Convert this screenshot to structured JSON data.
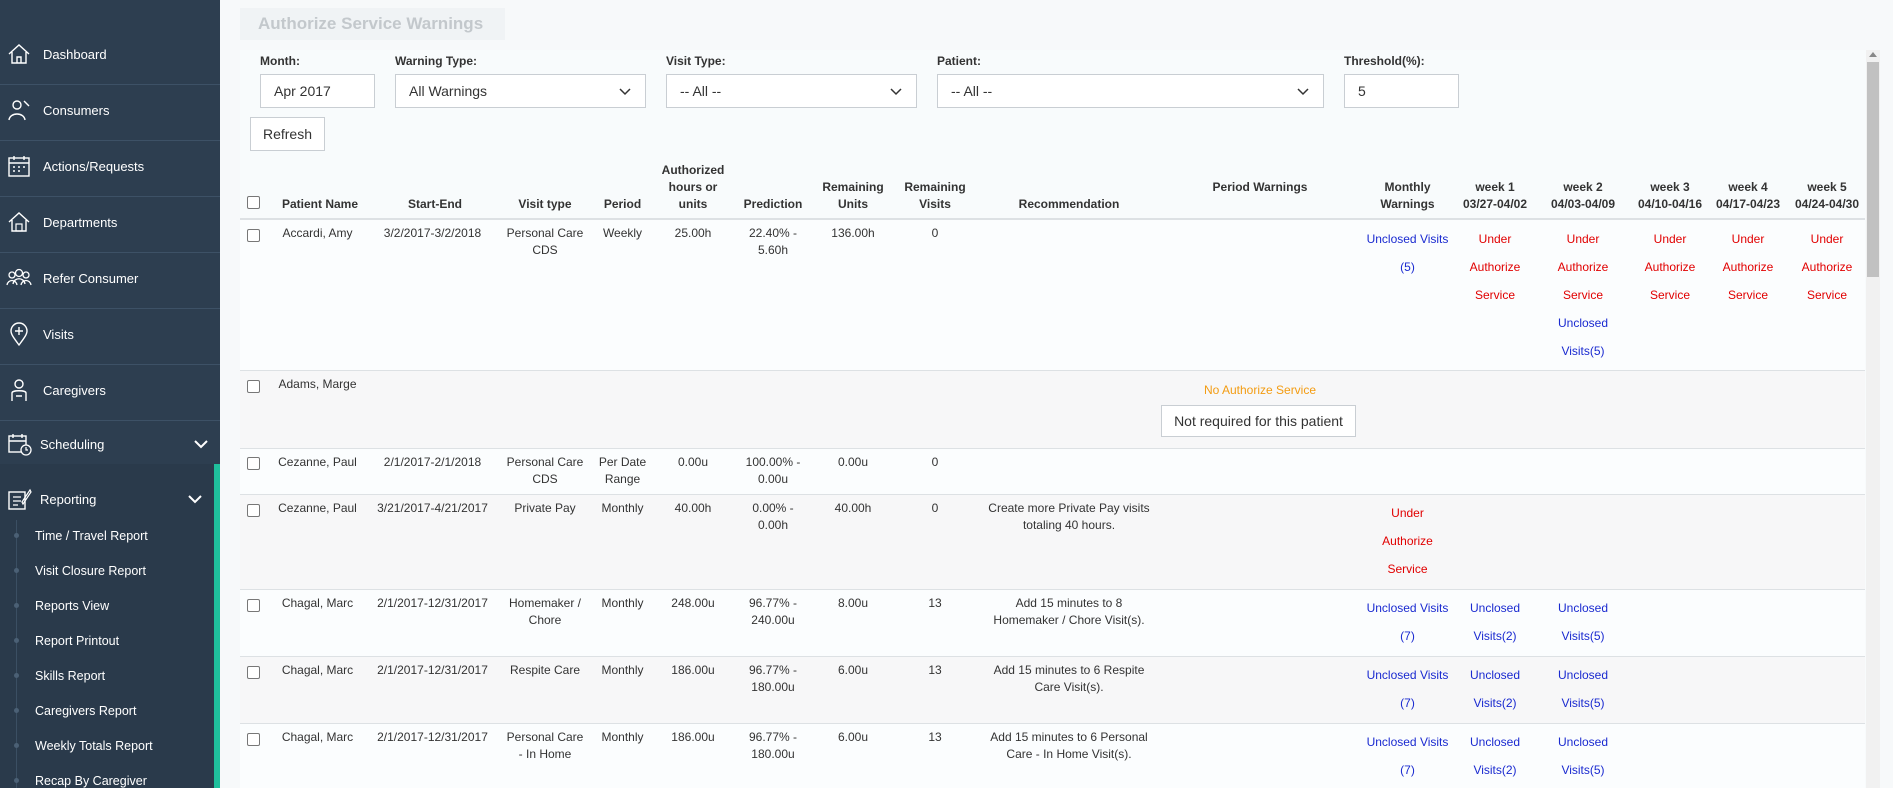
{
  "sidebar": {
    "items": [
      {
        "label": "Dashboard",
        "icon": "home-icon"
      },
      {
        "label": "Consumers",
        "icon": "consumer-icon"
      },
      {
        "label": "Actions/Requests",
        "icon": "calendar-icon"
      },
      {
        "label": "Departments",
        "icon": "building-icon"
      },
      {
        "label": "Refer Consumer",
        "icon": "group-icon"
      },
      {
        "label": "Visits",
        "icon": "location-pin-icon"
      },
      {
        "label": "Caregivers",
        "icon": "caregiver-icon"
      },
      {
        "label": "Scheduling",
        "icon": "schedule-icon"
      },
      {
        "label": "Reporting",
        "icon": "report-icon"
      }
    ],
    "reporting_subitems": [
      "Time / Travel Report",
      "Visit Closure Report",
      "Reports View",
      "Report Printout",
      "Skills Report",
      "Caregivers Report",
      "Weekly Totals Report",
      "Recap By Caregiver"
    ]
  },
  "page": {
    "title": "Authorize Service Warnings"
  },
  "filters": {
    "month_label": "Month:",
    "month_value": "Apr 2017",
    "warning_type_label": "Warning Type:",
    "warning_type_value": "All Warnings",
    "visit_type_label": "Visit Type:",
    "visit_type_value": "-- All --",
    "patient_label": "Patient:",
    "patient_value": "-- All --",
    "threshold_label": "Threshold(%):",
    "threshold_value": "5",
    "refresh_label": "Refresh"
  },
  "table": {
    "headers": {
      "patient_name": "Patient Name",
      "start_end": "Start-End",
      "visit_type": "Visit type",
      "period": "Period",
      "authorized": "Authorized hours or units",
      "prediction": "Prediction",
      "remaining_units": "Remaining Units",
      "remaining_visits": "Remaining Visits",
      "recommendation": "Recommendation",
      "period_warnings": "Period Warnings",
      "monthly_warnings": "Monthly Warnings",
      "week1": "week 1",
      "week1_range": "03/27-04/02",
      "week2": "week 2",
      "week2_range": "04/03-04/09",
      "week3": "week 3",
      "week3_range": "04/10-04/16",
      "week4": "week 4",
      "week4_range": "04/17-04/23",
      "week5": "week 5",
      "week5_range": "04/24-04/30"
    },
    "rows": [
      {
        "name": "Accardi, Amy",
        "start_end": "3/2/2017-3/2/2018",
        "visit_type_1": "Personal Care",
        "visit_type_2": "CDS",
        "period": "Weekly",
        "authorized": "25.00h",
        "prediction_1": "22.40% -",
        "prediction_2": "5.60h",
        "remaining_units": "136.00h",
        "remaining_visits": "0",
        "monthly_1": "Unclosed Visits",
        "monthly_2": "(5)",
        "w_under": "Under",
        "w_authorize": "Authorize",
        "w_service": "Service",
        "w2_unclosed": "Unclosed",
        "w2_visits": "Visits(5)"
      },
      {
        "name": "Adams, Marge",
        "no_auth": "No Authorize Service",
        "not_required": "Not required for this patient"
      },
      {
        "name": "Cezanne, Paul",
        "start_end": "2/1/2017-2/1/2018",
        "visit_type_1": "Personal Care",
        "visit_type_2": "CDS",
        "period_1": "Per Date",
        "period_2": "Range",
        "authorized": "0.00u",
        "prediction_1": "100.00% -",
        "prediction_2": "0.00u",
        "remaining_units": "0.00u",
        "remaining_visits": "0"
      },
      {
        "name": "Cezanne, Paul",
        "start_end": "3/21/2017-4/21/2017",
        "visit_type_1": "Private Pay",
        "period": "Monthly",
        "authorized": "40.00h",
        "prediction_1": "0.00% -",
        "prediction_2": "0.00h",
        "remaining_units": "40.00h",
        "remaining_visits": "0",
        "recommendation_1": "Create more Private Pay visits",
        "recommendation_2": "totaling 40 hours.",
        "monthly_under": "Under",
        "monthly_authorize": "Authorize",
        "monthly_service": "Service"
      },
      {
        "name": "Chagal, Marc",
        "start_end": "2/1/2017-12/31/2017",
        "visit_type_1": "Homemaker /",
        "visit_type_2": "Chore",
        "period": "Monthly",
        "authorized": "248.00u",
        "prediction_1": "96.77% -",
        "prediction_2": "240.00u",
        "remaining_units": "8.00u",
        "remaining_visits": "13",
        "recommendation_1": "Add 15 minutes to 8",
        "recommendation_2": "Homemaker / Chore Visit(s).",
        "monthly_1": "Unclosed Visits",
        "monthly_2": "(7)",
        "w1_1": "Unclosed",
        "w1_2": "Visits(2)",
        "w2_1": "Unclosed",
        "w2_2": "Visits(5)"
      },
      {
        "name": "Chagal, Marc",
        "start_end": "2/1/2017-12/31/2017",
        "visit_type_1": "Respite Care",
        "period": "Monthly",
        "authorized": "186.00u",
        "prediction_1": "96.77% -",
        "prediction_2": "180.00u",
        "remaining_units": "6.00u",
        "remaining_visits": "13",
        "recommendation_1": "Add 15 minutes to 6 Respite",
        "recommendation_2": "Care Visit(s).",
        "monthly_1": "Unclosed Visits",
        "monthly_2": "(7)",
        "w1_1": "Unclosed",
        "w1_2": "Visits(2)",
        "w2_1": "Unclosed",
        "w2_2": "Visits(5)"
      },
      {
        "name": "Chagal, Marc",
        "start_end": "2/1/2017-12/31/2017",
        "visit_type_1": "Personal Care",
        "visit_type_2": "- In Home",
        "period": "Monthly",
        "authorized": "186.00u",
        "prediction_1": "96.77% -",
        "prediction_2": "180.00u",
        "remaining_units": "6.00u",
        "remaining_visits": "13",
        "recommendation_1": "Add 15 minutes to 6 Personal",
        "recommendation_2": "Care - In Home Visit(s).",
        "monthly_1": "Unclosed Visits",
        "monthly_2": "(7)",
        "w1_1": "Unclosed",
        "w1_2": "Visits(2)",
        "w2_1": "Unclosed",
        "w2_2": "Visits(5)"
      }
    ]
  }
}
